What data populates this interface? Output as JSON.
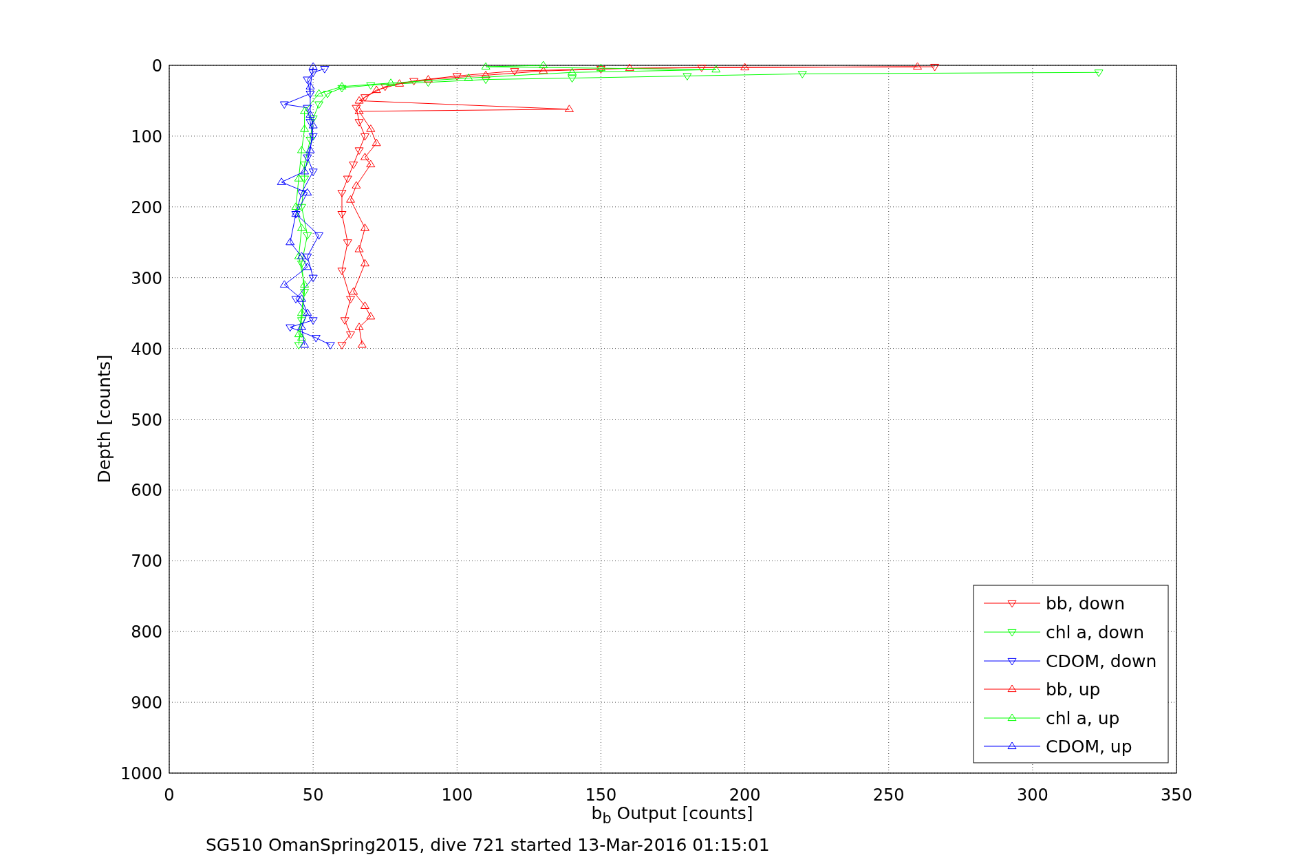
{
  "chart_data": {
    "type": "line",
    "xlabel": "b$_{b}$ Output [counts]",
    "ylabel": "Depth [counts]",
    "xlim": [
      0,
      350
    ],
    "ylim": [
      1000,
      0
    ],
    "xticks": [
      0,
      50,
      100,
      150,
      200,
      250,
      300,
      350
    ],
    "yticks": [
      0,
      100,
      200,
      300,
      400,
      500,
      600,
      700,
      800,
      900,
      1000
    ],
    "grid": true,
    "legend": true,
    "series": [
      {
        "name": "bb, down",
        "color": "#ff0000",
        "marker": "triangle",
        "x": [
          266,
          185,
          150,
          120,
          100,
          85,
          75,
          68,
          65,
          66,
          68,
          66,
          64,
          62,
          60,
          60,
          62,
          60,
          63,
          61,
          63,
          60
        ],
        "values": [
          2,
          3,
          5,
          8,
          15,
          22,
          30,
          45,
          60,
          80,
          100,
          120,
          140,
          160,
          180,
          210,
          250,
          290,
          330,
          360,
          380,
          395
        ]
      },
      {
        "name": "chl a, down",
        "color": "#00ff00",
        "marker": "triangle",
        "x": [
          323,
          220,
          180,
          140,
          110,
          90,
          70,
          60,
          55,
          52,
          50,
          49,
          47,
          47,
          46,
          48,
          46,
          47,
          46,
          45
        ],
        "values": [
          10,
          12,
          15,
          18,
          20,
          24,
          28,
          32,
          40,
          55,
          75,
          105,
          140,
          160,
          200,
          240,
          280,
          320,
          360,
          395
        ]
      },
      {
        "name": "CDOM, down",
        "color": "#0000ff",
        "marker": "triangle",
        "x": [
          54,
          50,
          48,
          49,
          40,
          48,
          49,
          50,
          48,
          50,
          46,
          44,
          52,
          48,
          50,
          44,
          50,
          42,
          51,
          56
        ],
        "values": [
          5,
          10,
          20,
          40,
          55,
          60,
          80,
          100,
          130,
          150,
          180,
          210,
          240,
          270,
          300,
          330,
          360,
          370,
          385,
          395
        ]
      },
      {
        "name": "bb, up",
        "color": "#ff0000",
        "marker": "triangle",
        "x": [
          260,
          200,
          160,
          130,
          110,
          90,
          80,
          72,
          66,
          139,
          66,
          70,
          72,
          68,
          70,
          65,
          63,
          68,
          66,
          68,
          64,
          68,
          70,
          66,
          67
        ],
        "values": [
          2,
          3,
          4,
          8,
          14,
          20,
          26,
          35,
          50,
          62,
          65,
          90,
          110,
          130,
          140,
          170,
          190,
          230,
          260,
          280,
          320,
          340,
          355,
          370,
          395
        ]
      },
      {
        "name": "chl a, up",
        "color": "#00ff00",
        "marker": "triangle",
        "x": [
          130,
          110,
          150,
          190,
          140,
          104,
          77,
          60,
          52,
          47,
          47,
          46,
          45,
          44,
          46,
          45,
          47,
          46,
          45,
          46
        ],
        "values": [
          0,
          2,
          4,
          6,
          10,
          18,
          25,
          30,
          40,
          65,
          90,
          120,
          160,
          200,
          230,
          270,
          310,
          350,
          380,
          385
        ]
      },
      {
        "name": "CDOM, up",
        "color": "#0000ff",
        "marker": "triangle",
        "x": [
          50,
          49,
          49,
          50,
          49,
          47,
          39,
          48,
          44,
          42,
          46,
          48,
          40,
          46,
          48,
          46,
          47
        ],
        "values": [
          2,
          30,
          70,
          85,
          120,
          150,
          165,
          180,
          210,
          250,
          270,
          285,
          310,
          330,
          350,
          370,
          395
        ]
      }
    ]
  },
  "caption": "SG510 OmanSpring2015, dive 721 started 13-Mar-2016 01:15:01"
}
